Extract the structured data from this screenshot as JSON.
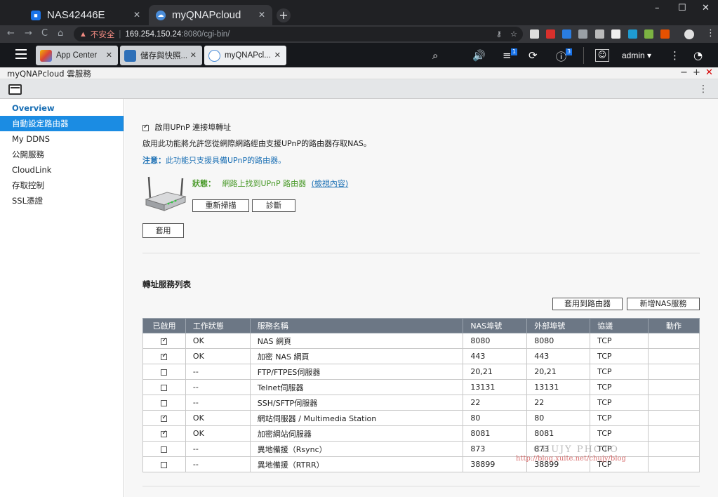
{
  "browser": {
    "tabs": [
      {
        "title": "NAS42446E",
        "icon": "nas-favicon-icon"
      },
      {
        "title": "myQNAPcloud",
        "icon": "cloud-favicon-icon"
      }
    ],
    "new_tab": "+",
    "window_controls": [
      "–",
      "☐",
      "✕"
    ],
    "nav": [
      "←",
      "→",
      "C",
      "⌂"
    ],
    "address": {
      "warning_icon": "▲",
      "insecure_label": "不安全",
      "separator": "|",
      "host": "169.254.150.24",
      "path": ":8080/cgi-bin/"
    },
    "address_icons": [
      "⚷",
      "☆"
    ]
  },
  "qts": {
    "tabs": [
      {
        "label": "App Center"
      },
      {
        "label": "儲存與快照..."
      },
      {
        "label": "myQNAPcl..."
      }
    ],
    "tab_close": "✕",
    "icons": {
      "search": "⌕",
      "volume": "🔊",
      "tasks": "≡",
      "sync": "⟳",
      "info": "ⓘ",
      "more": "⋮",
      "gauge": "◔"
    },
    "badges": {
      "tasks": "1",
      "info": "3"
    },
    "user": "admin ▾"
  },
  "window": {
    "title": "myQNAPcloud 雲服務",
    "controls": [
      "−",
      "+",
      "✕"
    ],
    "more": "⋮"
  },
  "sidebar": {
    "items": [
      {
        "label": "Overview"
      },
      {
        "label": "自動設定路由器"
      },
      {
        "label": "My DDNS"
      },
      {
        "label": "公開服務"
      },
      {
        "label": "CloudLink"
      },
      {
        "label": "存取控制"
      },
      {
        "label": "SSL憑證"
      }
    ]
  },
  "upnp": {
    "enable_label": "啟用UPnP 連接埠轉址",
    "enable_checked": true,
    "description": "啟用此功能將允許您從網際網路經由支援UPnP的路由器存取NAS。",
    "note_prefix": "注意：",
    "note_text": "此功能只支援具備UPnP的路由器。",
    "status_label": "狀態：",
    "status_text": "網路上找到UPnP 路由器",
    "status_link": "(檢視內容)",
    "rescan_button": "重新掃描",
    "diagnose_button": "診斷",
    "apply_button": "套用"
  },
  "service_list": {
    "title": "轉址服務列表",
    "apply_router_button": "套用到路由器",
    "add_service_button": "新增NAS服務",
    "columns": [
      "已啟用",
      "工作狀態",
      "服務名稱",
      "NAS埠號",
      "外部埠號",
      "協議",
      "動作"
    ],
    "rows": [
      {
        "enabled": true,
        "status": "OK",
        "name": "NAS 網頁",
        "nas_port": "8080",
        "ext_port": "8080",
        "protocol": "TCP"
      },
      {
        "enabled": true,
        "status": "OK",
        "name": "加密 NAS 網頁",
        "nas_port": "443",
        "ext_port": "443",
        "protocol": "TCP"
      },
      {
        "enabled": false,
        "status": "--",
        "name": "FTP/FTPES伺服器",
        "nas_port": "20,21",
        "ext_port": "20,21",
        "protocol": "TCP"
      },
      {
        "enabled": false,
        "status": "--",
        "name": "Telnet伺服器",
        "nas_port": "13131",
        "ext_port": "13131",
        "protocol": "TCP"
      },
      {
        "enabled": false,
        "status": "--",
        "name": "SSH/SFTP伺服器",
        "nas_port": "22",
        "ext_port": "22",
        "protocol": "TCP"
      },
      {
        "enabled": true,
        "status": "OK",
        "name": "網站伺服器 / Multimedia Station",
        "nas_port": "80",
        "ext_port": "80",
        "protocol": "TCP"
      },
      {
        "enabled": true,
        "status": "OK",
        "name": "加密網站伺服器",
        "nas_port": "8081",
        "ext_port": "8081",
        "protocol": "TCP"
      },
      {
        "enabled": false,
        "status": "--",
        "name": "異地備援（Rsync）",
        "nas_port": "873",
        "ext_port": "873",
        "protocol": "TCP"
      },
      {
        "enabled": false,
        "status": "--",
        "name": "異地備援（RTRR）",
        "nas_port": "38899",
        "ext_port": "38899",
        "protocol": "TCP"
      }
    ]
  },
  "watermark": {
    "line1": "CHUJY PHOTO",
    "line2": "http://blog.xuite.net/chujy/blog"
  }
}
